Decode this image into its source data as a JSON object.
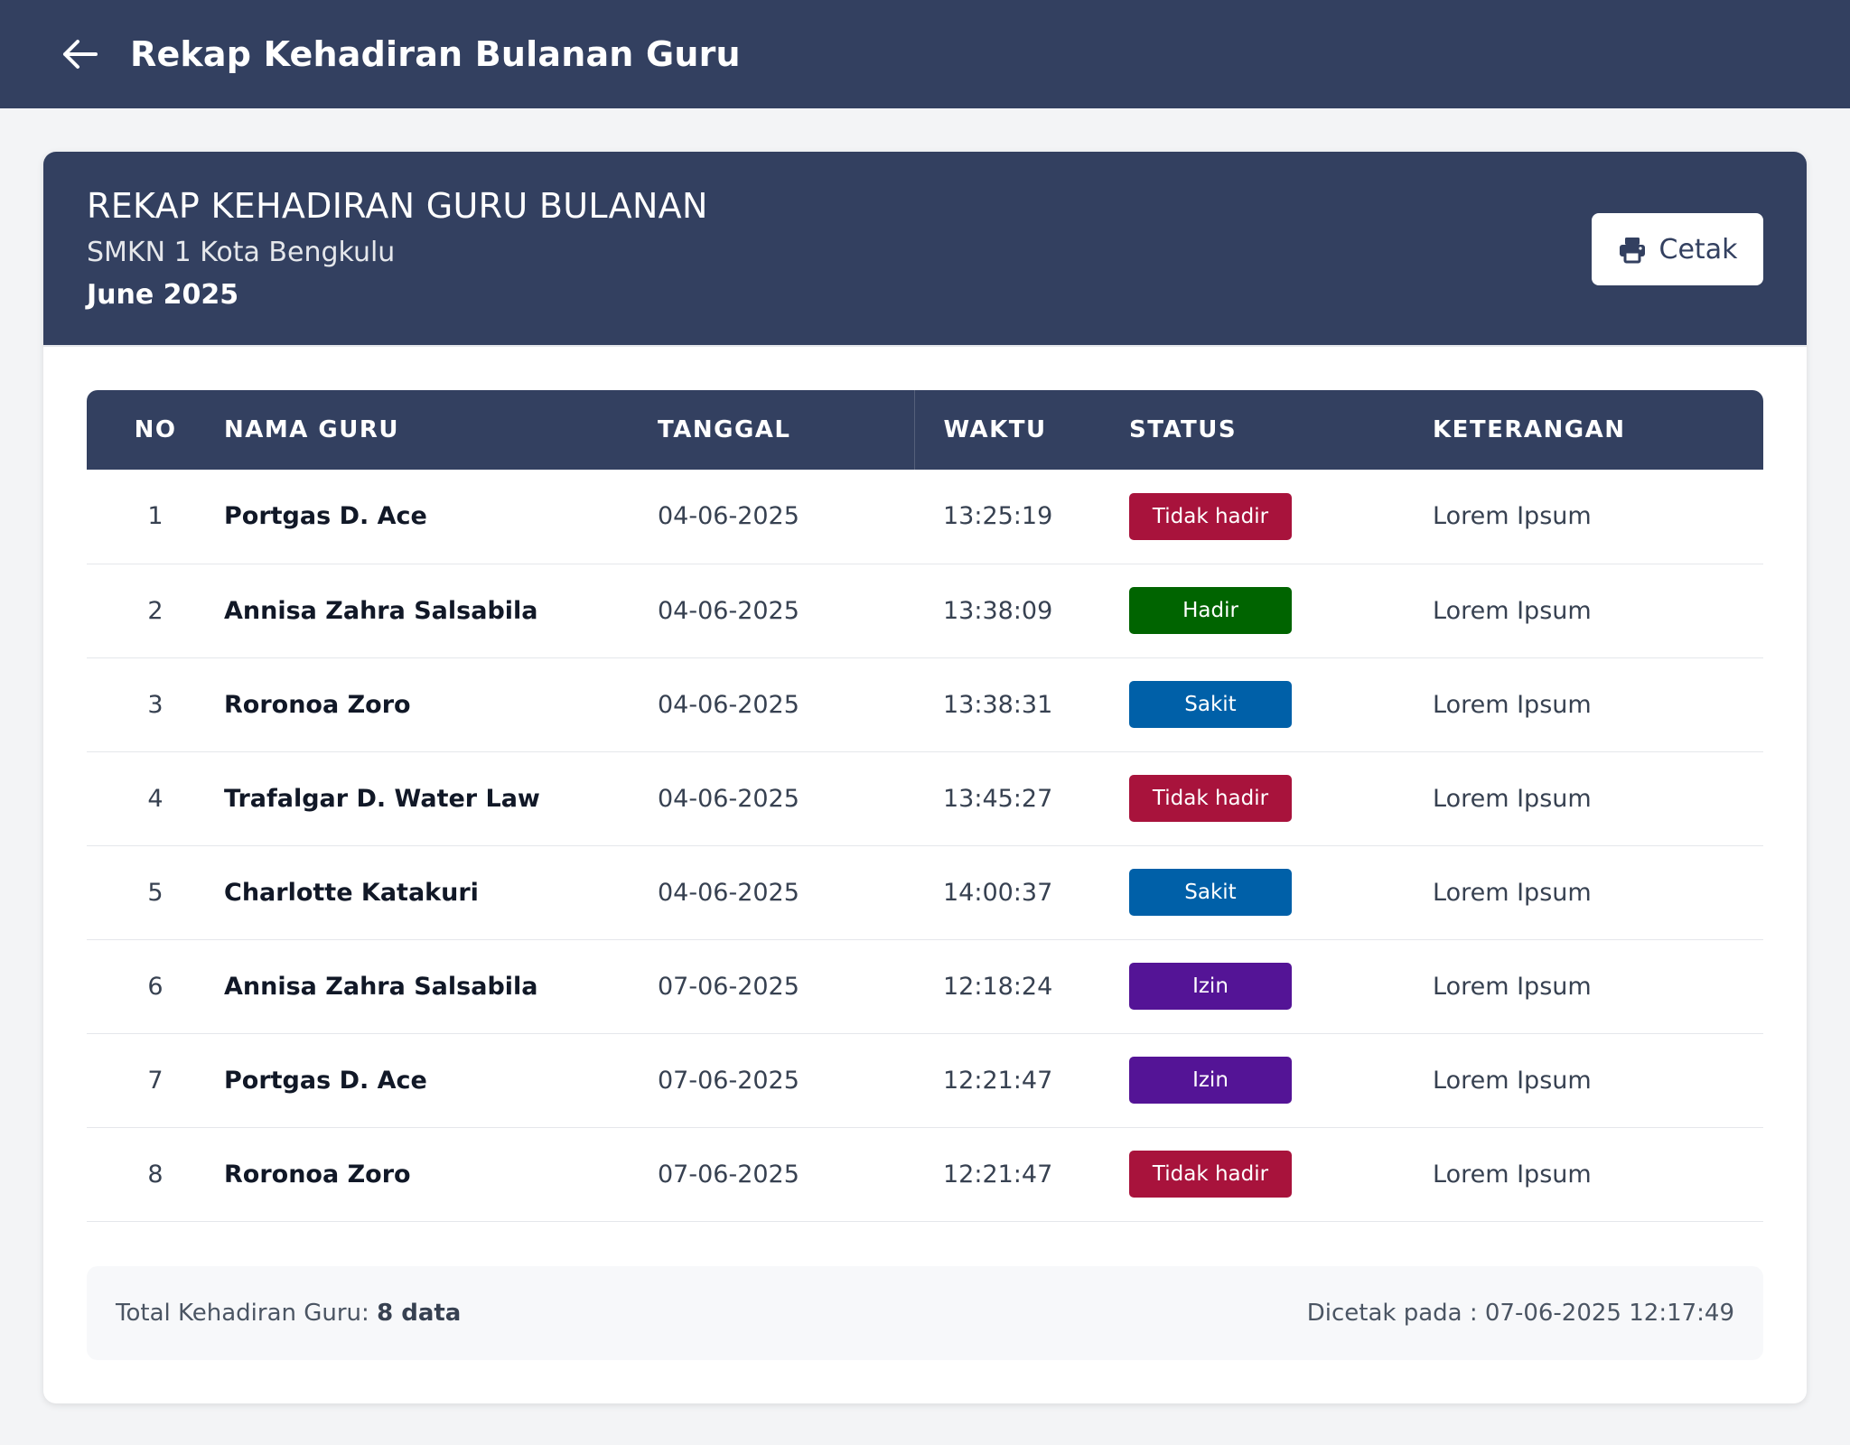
{
  "app": {
    "title": "Rekap Kehadiran Bulanan Guru"
  },
  "report": {
    "title": "REKAP KEHADIRAN GURU BULANAN",
    "school": "SMKN 1 Kota Bengkulu",
    "period": "June 2025",
    "print_label": "Cetak"
  },
  "table": {
    "headers": [
      "NO",
      "NAMA GURU",
      "TANGGAL",
      "WAKTU",
      "STATUS",
      "KETERANGAN"
    ],
    "rows": [
      {
        "no": "1",
        "name": "Portgas D. Ace",
        "date": "04-06-2025",
        "time": "13:25:19",
        "status": "Tidak hadir",
        "note": "Lorem Ipsum"
      },
      {
        "no": "2",
        "name": "Annisa Zahra Salsabila",
        "date": "04-06-2025",
        "time": "13:38:09",
        "status": "Hadir",
        "note": "Lorem Ipsum"
      },
      {
        "no": "3",
        "name": "Roronoa Zoro",
        "date": "04-06-2025",
        "time": "13:38:31",
        "status": "Sakit",
        "note": "Lorem Ipsum"
      },
      {
        "no": "4",
        "name": "Trafalgar D. Water Law",
        "date": "04-06-2025",
        "time": "13:45:27",
        "status": "Tidak hadir",
        "note": "Lorem Ipsum"
      },
      {
        "no": "5",
        "name": "Charlotte Katakuri",
        "date": "04-06-2025",
        "time": "14:00:37",
        "status": "Sakit",
        "note": "Lorem Ipsum"
      },
      {
        "no": "6",
        "name": "Annisa Zahra Salsabila",
        "date": "07-06-2025",
        "time": "12:18:24",
        "status": "Izin",
        "note": "Lorem Ipsum"
      },
      {
        "no": "7",
        "name": "Portgas D. Ace",
        "date": "07-06-2025",
        "time": "12:21:47",
        "status": "Izin",
        "note": "Lorem Ipsum"
      },
      {
        "no": "8",
        "name": "Roronoa Zoro",
        "date": "07-06-2025",
        "time": "12:21:47",
        "status": "Tidak hadir",
        "note": "Lorem Ipsum"
      }
    ]
  },
  "status_colors": {
    "Tidak hadir": "#a8133c",
    "Hadir": "#006400",
    "Sakit": "#0060a8",
    "Izin": "#541496"
  },
  "footer": {
    "total_label": "Total Kehadiran Guru: ",
    "total_value": "8 data",
    "printed_at": "Dicetak pada : 07-06-2025 12:17:49"
  },
  "colors": {
    "header_bg": "#334060",
    "page_bg": "#f3f4f6"
  }
}
